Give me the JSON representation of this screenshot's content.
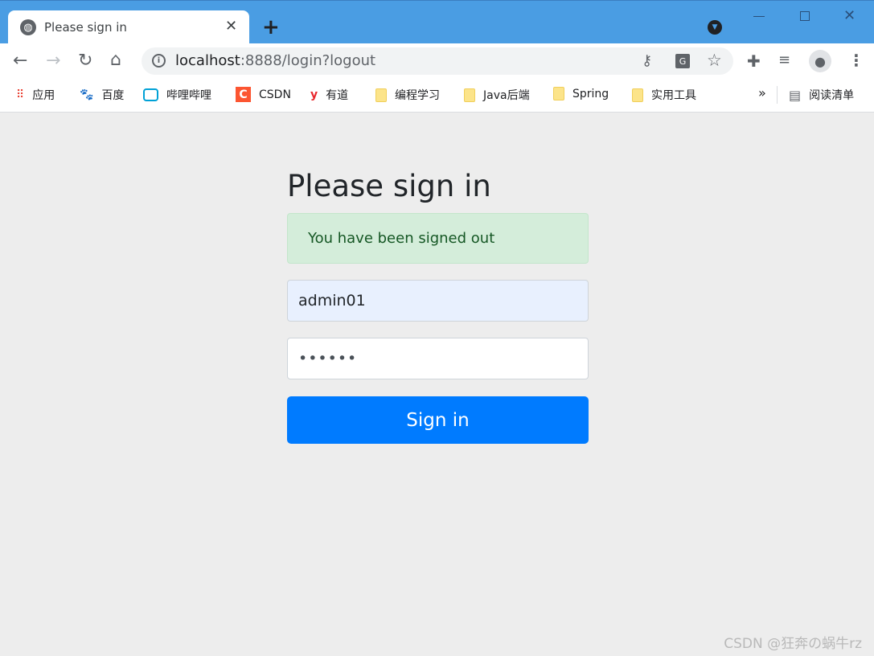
{
  "browser": {
    "tab_title": "Please sign in",
    "new_tab": "+",
    "url_host": "localhost",
    "url_rest": ":8888/login?logout",
    "bookmarks": [
      "应用",
      "百度",
      "哔哩哔哩",
      "CSDN",
      "有道",
      "编程学习",
      "Java后端",
      "Spring",
      "实用工具"
    ],
    "more": "»",
    "reading_list": "阅读清单",
    "theme_color": "#4a9de3"
  },
  "form": {
    "title": "Please sign in",
    "alert": "You have been signed out",
    "username": "admin01",
    "password": "••••••",
    "submit": "Sign in",
    "accent": "#007bff"
  },
  "watermark": "CSDN @狂奔の蜗牛rz"
}
